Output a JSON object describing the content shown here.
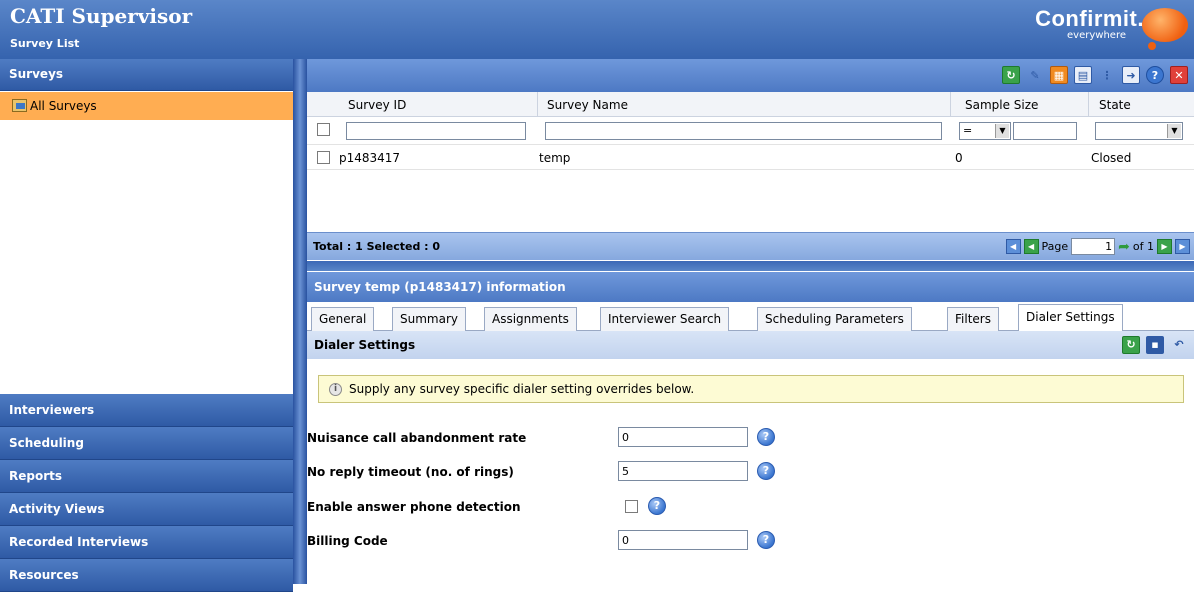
{
  "header": {
    "title": "CATI Supervisor",
    "subtitle": "Survey List",
    "brand": "Confirmit.",
    "brand_tag": "everywhere"
  },
  "sidebar": {
    "surveys_label": "Surveys",
    "all_surveys_label": "All Surveys",
    "sections": [
      "Interviewers",
      "Scheduling",
      "Reports",
      "Activity Views",
      "Recorded Interviews",
      "Resources"
    ]
  },
  "toolbar": {
    "icons": [
      "refresh-icon",
      "eraser-icon",
      "calendar-icon",
      "export-icon",
      "info-icon",
      "forward-icon",
      "help-icon",
      "close-icon"
    ]
  },
  "grid": {
    "columns": [
      "Survey ID",
      "Survey Name",
      "Sample Size",
      "State"
    ],
    "filter": {
      "sample_size_operator": "=",
      "survey_id": "",
      "survey_name": "",
      "sample_size": "",
      "state": ""
    },
    "rows": [
      {
        "survey_id": "p1483417",
        "survey_name": "temp",
        "sample_size": "0",
        "state": "Closed"
      }
    ]
  },
  "grid_footer": {
    "total_label": "Total : 1 Selected : 0",
    "page_label": "Page",
    "page_value": "1",
    "of_label": "of 1"
  },
  "info": {
    "title": "Survey temp (p1483417) information",
    "tabs": [
      "General",
      "Summary",
      "Assignments",
      "Interviewer Search",
      "Scheduling Parameters",
      "Filters",
      "Dialer Settings"
    ],
    "active_tab": "Dialer Settings",
    "section_title": "Dialer Settings",
    "notice": "Supply any survey specific dialer setting overrides below.",
    "fields": [
      {
        "label": "Nuisance call abandonment rate",
        "value": "0"
      },
      {
        "label": "No reply timeout (no. of rings)",
        "value": "5"
      },
      {
        "label": "Enable answer phone detection",
        "checked": false
      },
      {
        "label": "Billing Code",
        "value": "0"
      }
    ]
  }
}
